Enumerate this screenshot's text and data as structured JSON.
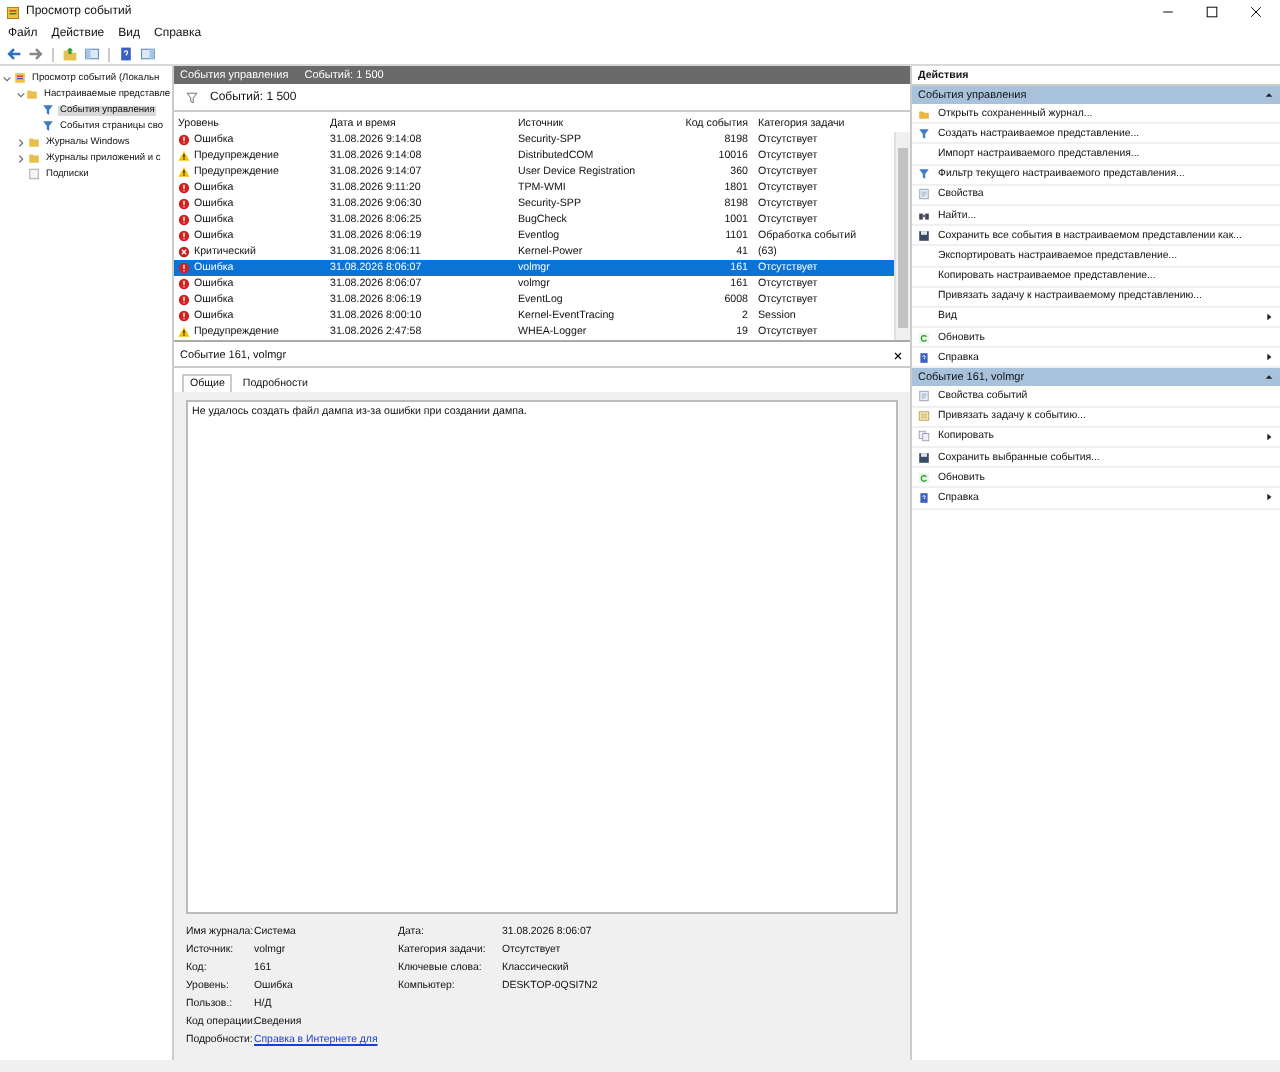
{
  "window": {
    "title": "Просмотр событий"
  },
  "menu": [
    "Файл",
    "Действие",
    "Вид",
    "Справка"
  ],
  "tree": [
    {
      "label": "Просмотр событий (Локальн",
      "kind": "root",
      "selected": false,
      "expanded": true,
      "children": [
        {
          "label": "Настраиваемые представле",
          "kind": "folder",
          "selected": false,
          "expanded": true,
          "children": [
            {
              "label": "События управления",
              "kind": "filter",
              "selected": true
            },
            {
              "label": "События страницы сво",
              "kind": "filter",
              "selected": false
            }
          ]
        },
        {
          "label": "Журналы Windows",
          "kind": "folder",
          "selected": false,
          "expanded": false
        },
        {
          "label": "Журналы приложений и с",
          "kind": "folder",
          "selected": false,
          "expanded": false
        },
        {
          "label": "Подписки",
          "kind": "log",
          "selected": false
        }
      ]
    }
  ],
  "view_header": {
    "title": "События управления",
    "count": "Событий: 1 500"
  },
  "filter_bar": {
    "text": "Событий: 1 500"
  },
  "table": {
    "columns": [
      "Уровень",
      "Дата и время",
      "Источник",
      "Код события",
      "Категория задачи"
    ],
    "rows": [
      {
        "kind": "error",
        "level": "Ошибка",
        "date": "31.08.2026 9:14:08",
        "source": "Security-SPP",
        "code": "8198",
        "category": "Отсутствует",
        "selected": false
      },
      {
        "kind": "warning",
        "level": "Предупреждение",
        "date": "31.08.2026 9:14:08",
        "source": "DistributedCOM",
        "code": "10016",
        "category": "Отсутствует",
        "selected": false
      },
      {
        "kind": "warning",
        "level": "Предупреждение",
        "date": "31.08.2026 9:14:07",
        "source": "User Device Registration",
        "code": "360",
        "category": "Отсутствует",
        "selected": false
      },
      {
        "kind": "error",
        "level": "Ошибка",
        "date": "31.08.2026 9:11:20",
        "source": "TPM-WMI",
        "code": "1801",
        "category": "Отсутствует",
        "selected": false
      },
      {
        "kind": "error",
        "level": "Ошибка",
        "date": "31.08.2026 9:06:30",
        "source": "Security-SPP",
        "code": "8198",
        "category": "Отсутствует",
        "selected": false
      },
      {
        "kind": "error",
        "level": "Ошибка",
        "date": "31.08.2026 8:06:25",
        "source": "BugCheck",
        "code": "1001",
        "category": "Отсутствует",
        "selected": false
      },
      {
        "kind": "error",
        "level": "Ошибка",
        "date": "31.08.2026 8:06:19",
        "source": "Eventlog",
        "code": "1101",
        "category": "Обработка событий",
        "selected": false
      },
      {
        "kind": "critical",
        "level": "Критический",
        "date": "31.08.2026 8:06:11",
        "source": "Kernel-Power",
        "code": "41",
        "category": "(63)",
        "selected": false
      },
      {
        "kind": "error",
        "level": "Ошибка",
        "date": "31.08.2026 8:06:07",
        "source": "volmgr",
        "code": "161",
        "category": "Отсутствует",
        "selected": true
      },
      {
        "kind": "error",
        "level": "Ошибка",
        "date": "31.08.2026 8:06:07",
        "source": "volmgr",
        "code": "161",
        "category": "Отсутствует",
        "selected": false
      },
      {
        "kind": "error",
        "level": "Ошибка",
        "date": "31.08.2026 8:06:19",
        "source": "EventLog",
        "code": "6008",
        "category": "Отсутствует",
        "selected": false
      },
      {
        "kind": "error",
        "level": "Ошибка",
        "date": "31.08.2026 8:00:10",
        "source": "Kernel-EventTracing",
        "code": "2",
        "category": "Session",
        "selected": false
      },
      {
        "kind": "warning",
        "level": "Предупреждение",
        "date": "31.08.2026 2:47:58",
        "source": "WHEA-Logger",
        "code": "19",
        "category": "Отсутствует",
        "selected": false
      }
    ]
  },
  "detail": {
    "title": "Событие 161, volmgr",
    "tabs": [
      {
        "label": "Общие",
        "selected": true
      },
      {
        "label": "Подробности",
        "selected": false
      }
    ],
    "message": "Не удалось создать файл дампа из-за ошибки при создании дампа.",
    "fields_left": [
      {
        "label": "Имя журнала:",
        "value": "Система"
      },
      {
        "label": "Источник:",
        "value": "volmgr"
      },
      {
        "label": "Код:",
        "value": "161"
      },
      {
        "label": "Уровень:",
        "value": "Ошибка"
      },
      {
        "label": "Пользов.:",
        "value": "Н/Д"
      },
      {
        "label": "Код операции:",
        "value": "Сведения"
      }
    ],
    "fields_right": [
      {
        "label": "Дата:",
        "value": "31.08.2026 8:06:07"
      },
      {
        "label": "Категория задачи:",
        "value": "Отсутствует"
      },
      {
        "label": "Ключевые слова:",
        "value": "Классический"
      },
      {
        "label": "Компьютер:",
        "value": "DESKTOP-0QSI7N2"
      }
    ],
    "more_label": "Подробности:",
    "more_link": "Справка в Интернете для"
  },
  "actions": {
    "title": "Действия",
    "sections": [
      {
        "title": "События управления",
        "items": [
          {
            "kind": "folder",
            "label": "Открыть сохраненный журнал...",
            "submenu": false
          },
          {
            "kind": "filter",
            "label": "Создать настраиваемое представление...",
            "submenu": false
          },
          {
            "kind": "plain",
            "label": "Импорт настраиваемого представления...",
            "submenu": false
          },
          {
            "kind": "filter",
            "label": "Фильтр текущего настраиваемого представления...",
            "submenu": false
          },
          {
            "kind": "properties",
            "label": "Свойства",
            "submenu": false
          },
          {
            "kind": "find",
            "label": "Найти...",
            "submenu": false
          },
          {
            "kind": "save",
            "label": "Сохранить все события в настраиваемом представлении как...",
            "submenu": false
          },
          {
            "kind": "plain",
            "label": "Экспортировать настраиваемое представление...",
            "submenu": false
          },
          {
            "kind": "plain",
            "label": "Копировать настраиваемое представление...",
            "submenu": false
          },
          {
            "kind": "plain",
            "label": "Привязать задачу к настраиваемому представлению...",
            "submenu": false
          },
          {
            "kind": "plain",
            "label": "Вид",
            "submenu": true
          },
          {
            "kind": "refresh",
            "label": "Обновить",
            "submenu": false
          },
          {
            "kind": "help",
            "label": "Справка",
            "submenu": true
          }
        ]
      },
      {
        "title": "Событие 161, volmgr",
        "items": [
          {
            "kind": "properties",
            "label": "Свойства событий",
            "submenu": false
          },
          {
            "kind": "task",
            "label": "Привязать задачу к событию...",
            "submenu": false
          },
          {
            "kind": "copy",
            "label": "Копировать",
            "submenu": true
          },
          {
            "kind": "save",
            "label": "Сохранить выбранные события...",
            "submenu": false
          },
          {
            "kind": "refresh",
            "label": "Обновить",
            "submenu": false
          },
          {
            "kind": "help",
            "label": "Справка",
            "submenu": true
          }
        ]
      }
    ]
  }
}
